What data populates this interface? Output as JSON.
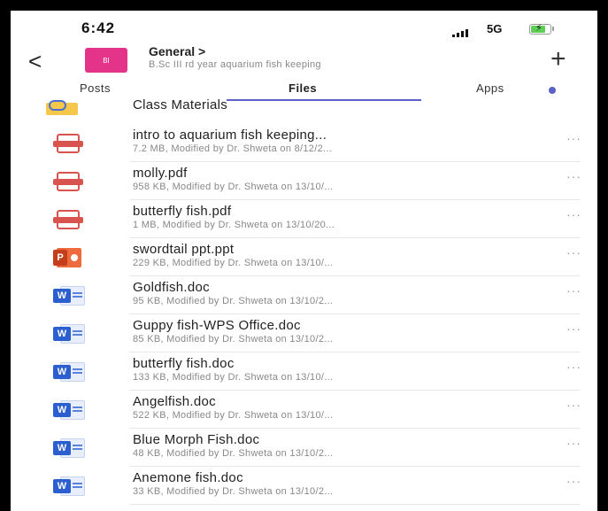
{
  "status_bar": {
    "time": "6:42",
    "network": "5G"
  },
  "header": {
    "avatar_initials": "BI",
    "channel_title": "General >",
    "channel_subtitle": "B.Sc III rd year aquarium fish keeping",
    "add_symbol": "+",
    "back_symbol": "<"
  },
  "tabs": [
    {
      "label": "Posts"
    },
    {
      "label": "Files"
    },
    {
      "label": "Apps"
    }
  ],
  "folder": {
    "label": "Class Materials"
  },
  "more_symbol": "···",
  "files": [
    {
      "type": "pdf",
      "name": "intro to aquarium fish keeping...",
      "meta": "7.2 MB, Modified by Dr. Shweta on 8/12/2..."
    },
    {
      "type": "pdf",
      "name": "molly.pdf",
      "meta": "958 KB, Modified by Dr. Shweta on 13/10/..."
    },
    {
      "type": "pdf",
      "name": "butterfly fish.pdf",
      "meta": "1 MB, Modified by Dr. Shweta on 13/10/20..."
    },
    {
      "type": "ppt",
      "name": "swordtail ppt.ppt",
      "meta": "229 KB, Modified by Dr. Shweta on 13/10/..."
    },
    {
      "type": "doc",
      "name": "Goldfish.doc",
      "meta": "95 KB, Modified by Dr. Shweta on 13/10/2..."
    },
    {
      "type": "doc",
      "name": "Guppy fish-WPS Office.doc",
      "meta": "85 KB, Modified by Dr. Shweta on 13/10/2..."
    },
    {
      "type": "doc",
      "name": "butterfly fish.doc",
      "meta": "133 KB, Modified by Dr. Shweta on 13/10/..."
    },
    {
      "type": "doc",
      "name": "Angelfish.doc",
      "meta": "522 KB, Modified by Dr. Shweta on 13/10/..."
    },
    {
      "type": "doc",
      "name": "Blue Morph Fish.doc",
      "meta": "48 KB, Modified by Dr. Shweta on 13/10/2..."
    },
    {
      "type": "doc",
      "name": "Anemone fish.doc",
      "meta": "33 KB, Modified by Dr. Shweta on 13/10/2..."
    }
  ],
  "colors": {
    "accent": "#5b5fc7",
    "avatar": "#e3348a",
    "pdf": "#d9534f",
    "ppt": "#c43e1c",
    "doc": "#2b5fd0"
  }
}
